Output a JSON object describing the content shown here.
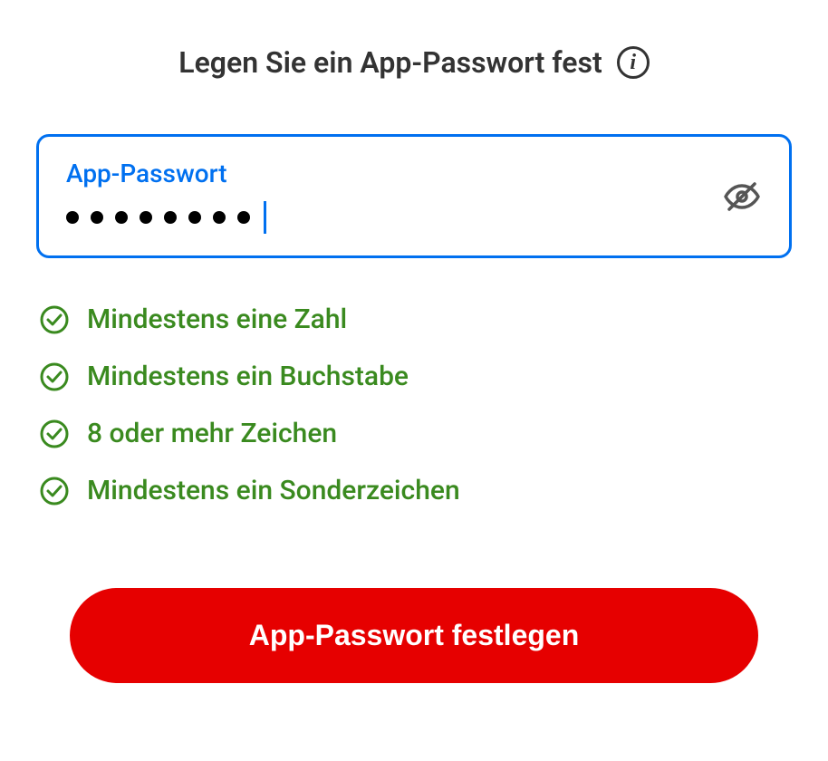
{
  "header": {
    "title": "Legen Sie ein App-Passwort fest"
  },
  "input": {
    "label": "App-Passwort",
    "masked_length": 8
  },
  "requirements": [
    {
      "text": "Mindestens eine Zahl"
    },
    {
      "text": "Mindestens ein Buchstabe"
    },
    {
      "text": "8 oder mehr Zeichen"
    },
    {
      "text": "Mindestens ein Sonderzeichen"
    }
  ],
  "button": {
    "label": "App-Passwort festlegen"
  }
}
